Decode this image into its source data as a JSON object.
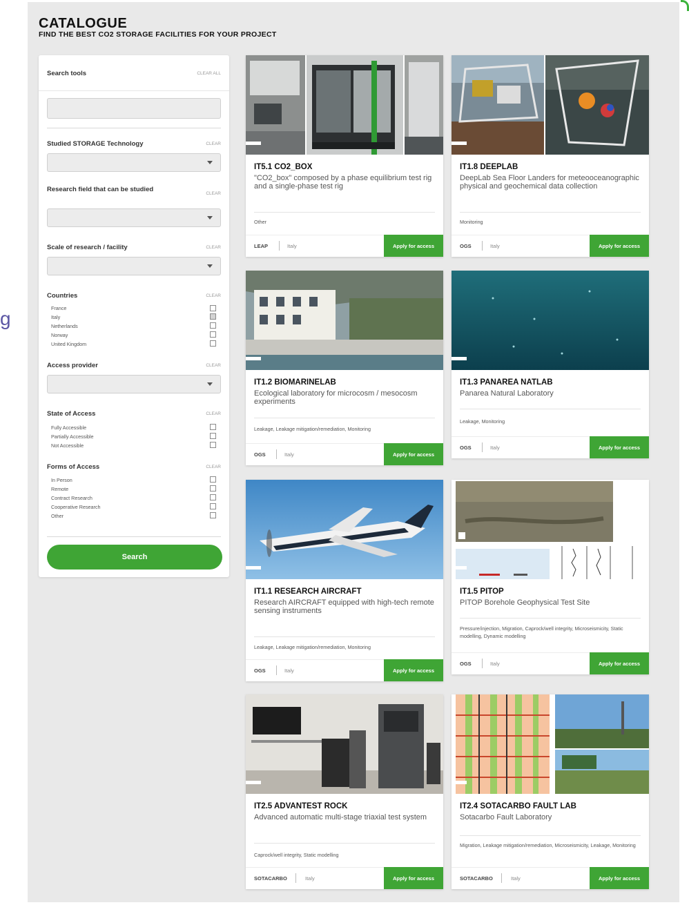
{
  "outside_text": "g",
  "header": {
    "title": "CATALOGUE",
    "subtitle": "FIND THE BEST CO2 STORAGE FACILITIES FOR YOUR PROJECT"
  },
  "sidebar": {
    "search_tools_label": "Search tools",
    "clear_all_label": "CLEAR ALL",
    "clear_label": "CLEAR",
    "search_placeholder": "",
    "filters": [
      {
        "label": "Studied STORAGE Technology"
      },
      {
        "label": "Research field that can be studied"
      },
      {
        "label": "Scale of research / facility"
      }
    ],
    "countries": {
      "label": "Countries",
      "options": [
        {
          "name": "France",
          "checked": false
        },
        {
          "name": "Italy",
          "checked": true
        },
        {
          "name": "Netherlands",
          "checked": false
        },
        {
          "name": "Norway",
          "checked": false
        },
        {
          "name": "United Kingdom",
          "checked": false
        }
      ]
    },
    "access_provider": {
      "label": "Access provider"
    },
    "state_of_access": {
      "label": "State of Access",
      "options": [
        {
          "name": "Fully Accessible",
          "checked": false
        },
        {
          "name": "Partially Accessible",
          "checked": false
        },
        {
          "name": "Not Accessible",
          "checked": false
        }
      ]
    },
    "forms_of_access": {
      "label": "Forms of Access",
      "options": [
        {
          "name": "In Person",
          "checked": false
        },
        {
          "name": "Remote",
          "checked": false
        },
        {
          "name": "Contract Research",
          "checked": false
        },
        {
          "name": "Cooperative Research",
          "checked": false
        },
        {
          "name": "Other",
          "checked": false
        }
      ]
    },
    "search_button": "Search"
  },
  "cards": [
    {
      "title": "IT5.1 CO2_BOX",
      "description": "\"CO2_box\" composed by a phase equilibrium test rig and a single-phase test rig",
      "tags": "Other",
      "provider": "LEAP",
      "country": "Italy",
      "apply": "Apply for access"
    },
    {
      "title": "IT1.8 DEEPLAB",
      "description": "DeepLab Sea Floor Landers for meteooceanographic physical and geochemical data collection",
      "tags": "Monitoring",
      "provider": "OGS",
      "country": "Italy",
      "apply": "Apply for access"
    },
    {
      "title": "IT1.2 BIOMARINELAB",
      "description": "Ecological laboratory for microcosm / mesocosm experiments",
      "tags": "Leakage, Leakage mitigation/remediation, Monitoring",
      "provider": "OGS",
      "country": "Italy",
      "apply": "Apply for access"
    },
    {
      "title": "IT1.3 PANAREA NATLAB",
      "description": "Panarea Natural Laboratory",
      "tags": "Leakage, Monitoring",
      "provider": "OGS",
      "country": "Italy",
      "apply": "Apply for access"
    },
    {
      "title": "IT1.1 RESEARCH AIRCRAFT",
      "description": "Research AIRCRAFT equipped with high-tech remote sensing instruments",
      "tags": "Leakage, Leakage mitigation/remediation, Monitoring",
      "provider": "OGS",
      "country": "Italy",
      "apply": "Apply for access"
    },
    {
      "title": "IT1.5 PITOP",
      "description": "PITOP Borehole Geophysical Test Site",
      "tags": "Pressure/injection, Migration, Caprock/well integrity, Microseismicity, Static modelling, Dynamic modelling",
      "provider": "OGS",
      "country": "Italy",
      "apply": "Apply for access"
    },
    {
      "title": "IT2.5 ADVANTEST ROCK",
      "description": "Advanced automatic multi-stage triaxial test system",
      "tags": "Caprock/well integrity, Static modelling",
      "provider": "SOTACARBO",
      "country": "Italy",
      "apply": "Apply for access"
    },
    {
      "title": "IT2.4 SOTACARBO FAULT LAB",
      "description": "Sotacarbo Fault Laboratory",
      "tags": "Migration, Leakage mitigation/remediation, Microseismicity, Leakage, Monitoring",
      "provider": "SOTACARBO",
      "country": "Italy",
      "apply": "Apply for access"
    }
  ]
}
